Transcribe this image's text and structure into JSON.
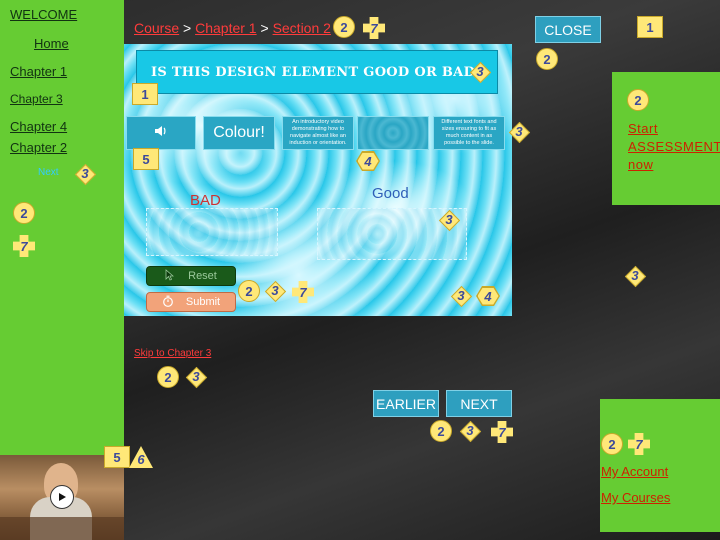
{
  "nav": {
    "welcome": "WELCOME",
    "home": "Home",
    "chapters": [
      "Chapter 1",
      "Chapter 3",
      "Chapter 4",
      "Chapter 2"
    ],
    "next_label": "Next"
  },
  "breadcrumb": {
    "course": "Course",
    "chapter": "Chapter 1",
    "section": "Section 2",
    "separator": ">"
  },
  "header": {
    "close_label": "CLOSE"
  },
  "slide": {
    "question": "IS THIS DESIGN ELEMENT GOOD OR BAD?",
    "options": {
      "audio_icon": "speaker-icon",
      "colour": "Colour!",
      "video_text": "An introductory video demonstrating how to navigate almost like an induction or orientation.",
      "fonts_text": "Different text fonts and sizes ensuring to fit as much content in as possible to the slide."
    },
    "bad_label": "BAD",
    "good_label": "Good",
    "reset_label": "Reset",
    "submit_label": "Submit"
  },
  "skip_link": "Skip to Chapter 3",
  "footer_nav": {
    "earlier": "EARLIER",
    "next": "NEXT"
  },
  "right_panel": {
    "assessment_link": "Start ASSESSMENT now"
  },
  "account_panel": {
    "account": "My Account",
    "courses": "My Courses"
  },
  "markers": {
    "one": "1",
    "two": "2",
    "three": "3",
    "four": "4",
    "five": "5",
    "six": "6",
    "seven": "7"
  },
  "colors": {
    "nav_green": "#66cc33",
    "link_red": "#ff3b3b",
    "button_teal": "#2e9fbf",
    "marker_yellow": "#ffe878",
    "slide_cyan": "#35c8ea"
  }
}
